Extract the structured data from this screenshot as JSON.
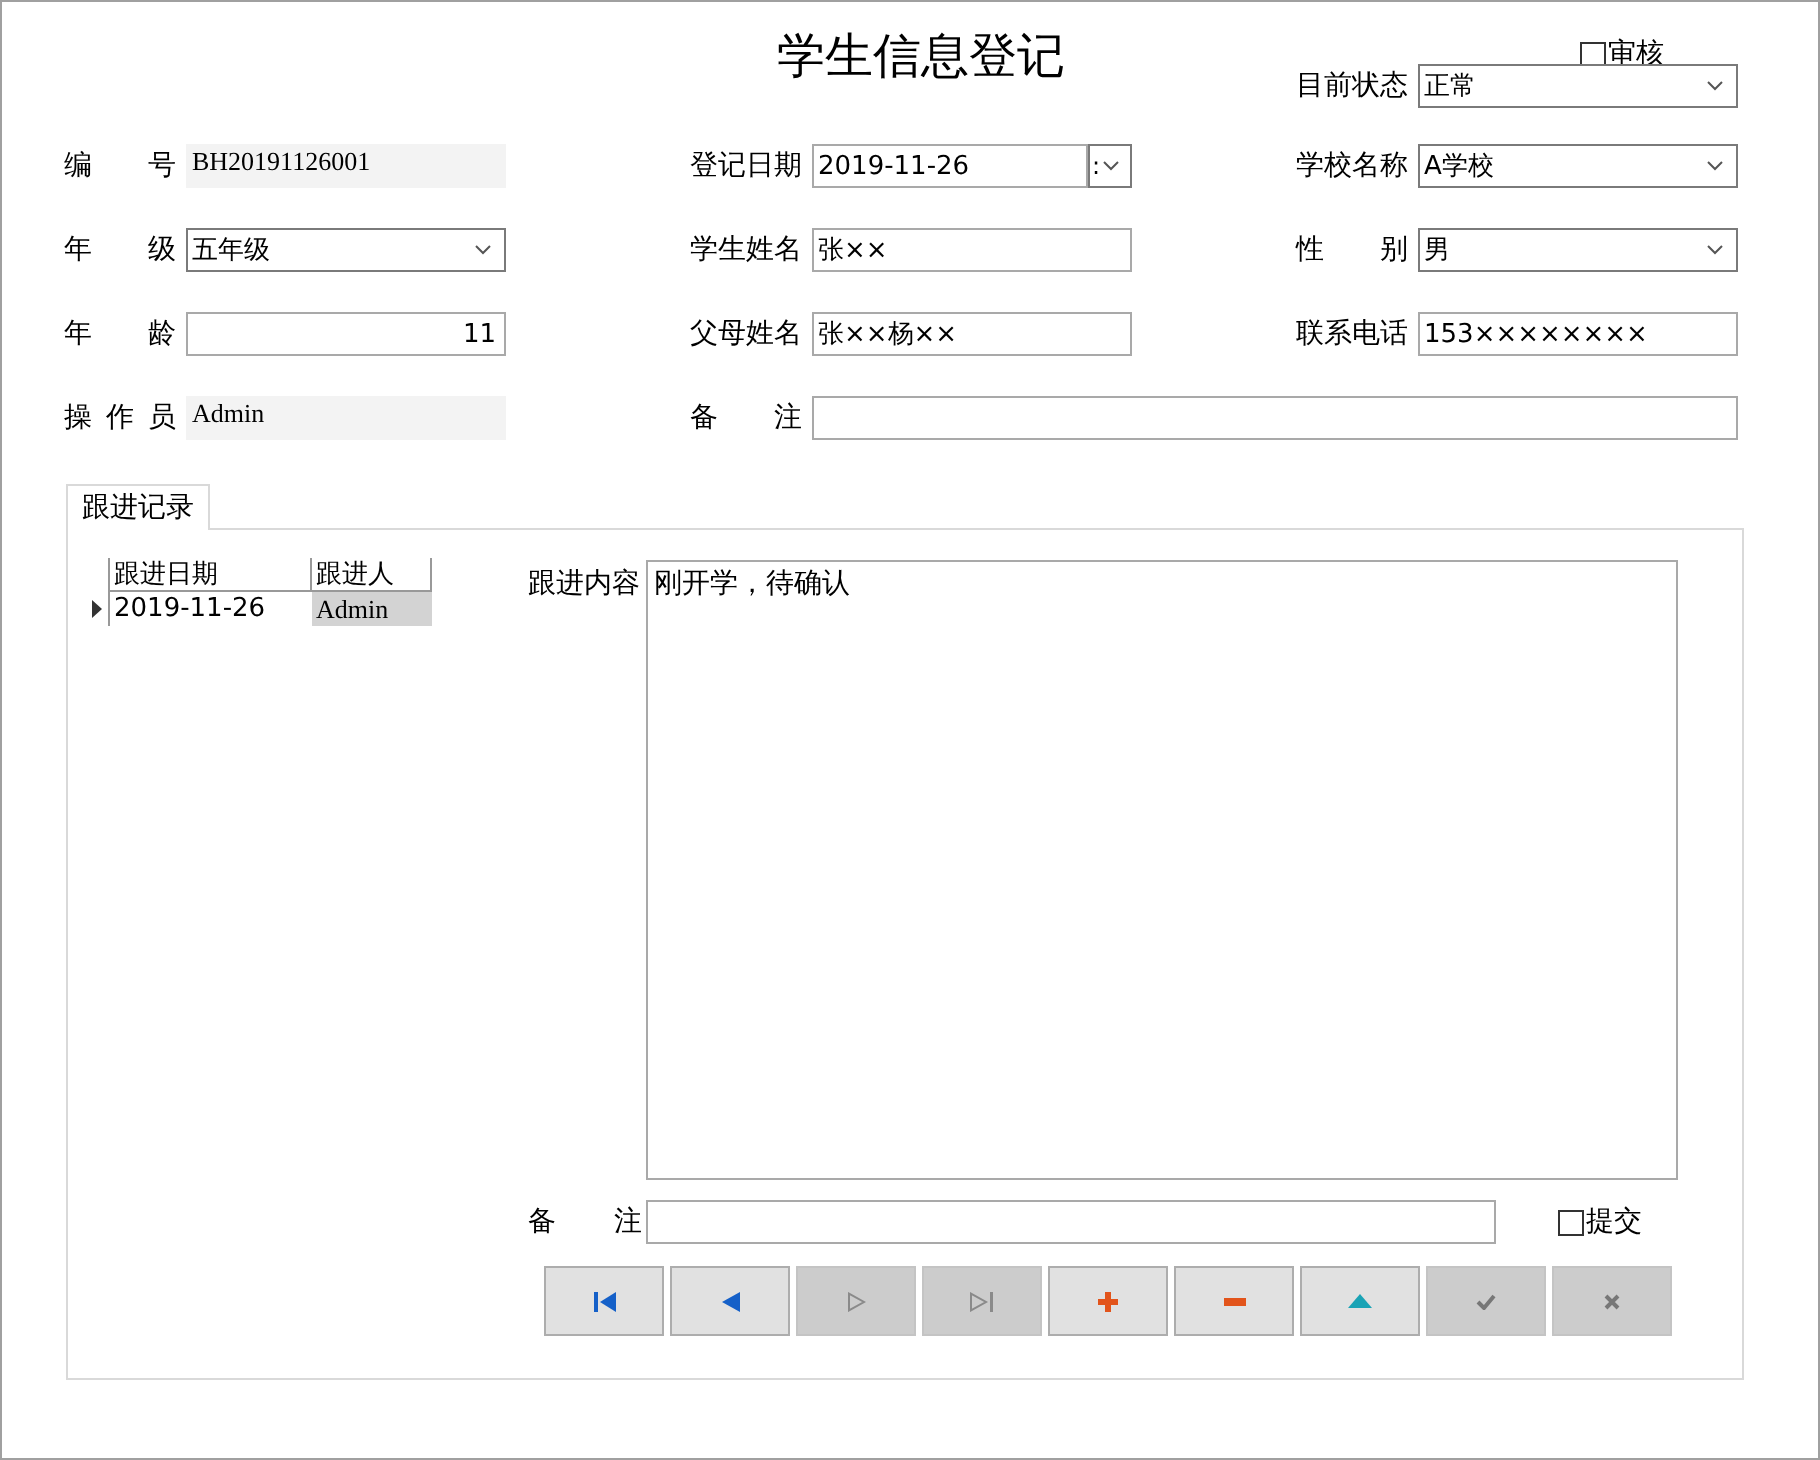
{
  "title": "学生信息登记",
  "audit": {
    "label": "审核",
    "checked": false
  },
  "status_field": {
    "label": "目前状态",
    "kind": "combo",
    "value": "正常"
  },
  "form_rows": [
    {
      "cells": [
        {
          "label": "编 号",
          "kind": "readonly",
          "value": "BH20191126001"
        },
        {
          "label": "登记日期",
          "kind": "date",
          "value": "2019-11-26",
          "spin_text": ":"
        },
        {
          "label": "学校名称",
          "kind": "combo",
          "value": "A学校"
        }
      ]
    },
    {
      "cells": [
        {
          "label": "年 级",
          "kind": "combo",
          "value": "五年级"
        },
        {
          "label": "学生姓名",
          "kind": "text",
          "value": "张××"
        },
        {
          "label": "性 别",
          "kind": "combo",
          "value": "男"
        }
      ]
    },
    {
      "cells": [
        {
          "label": "年 龄",
          "kind": "number",
          "value": "11"
        },
        {
          "label": "父母姓名",
          "kind": "text",
          "value": "张××杨××"
        },
        {
          "label": "联系电话",
          "kind": "text",
          "value": "153××××××××"
        }
      ]
    },
    {
      "cells": [
        {
          "label": "操 作 员",
          "kind": "readonly",
          "value": "Admin"
        },
        {
          "label": "备 注",
          "kind": "text"
        }
      ]
    }
  ],
  "tabs": [
    {
      "label": "跟进记录",
      "selected": true
    }
  ],
  "followup_grid": {
    "columns": [
      "跟进日期",
      "跟进人"
    ],
    "rows": [
      {
        "current": true,
        "cells": [
          {
            "text": "2019-11-26",
            "selected": false
          },
          {
            "text": "Admin",
            "selected": true
          }
        ]
      }
    ]
  },
  "content": {
    "label": "跟进内容",
    "value": "刚开学，待确认"
  },
  "remark": {
    "label": "备 注"
  },
  "submit": {
    "label": "提交",
    "checked": false
  },
  "nav_buttons": [
    {
      "kind": "first",
      "disabled": false
    },
    {
      "kind": "prev",
      "disabled": false
    },
    {
      "kind": "next",
      "disabled": true
    },
    {
      "kind": "last",
      "disabled": true
    },
    {
      "kind": "add",
      "disabled": false
    },
    {
      "kind": "remove",
      "disabled": false
    },
    {
      "kind": "edit",
      "disabled": false
    },
    {
      "kind": "save",
      "disabled": true
    },
    {
      "kind": "cancel",
      "disabled": true
    }
  ]
}
